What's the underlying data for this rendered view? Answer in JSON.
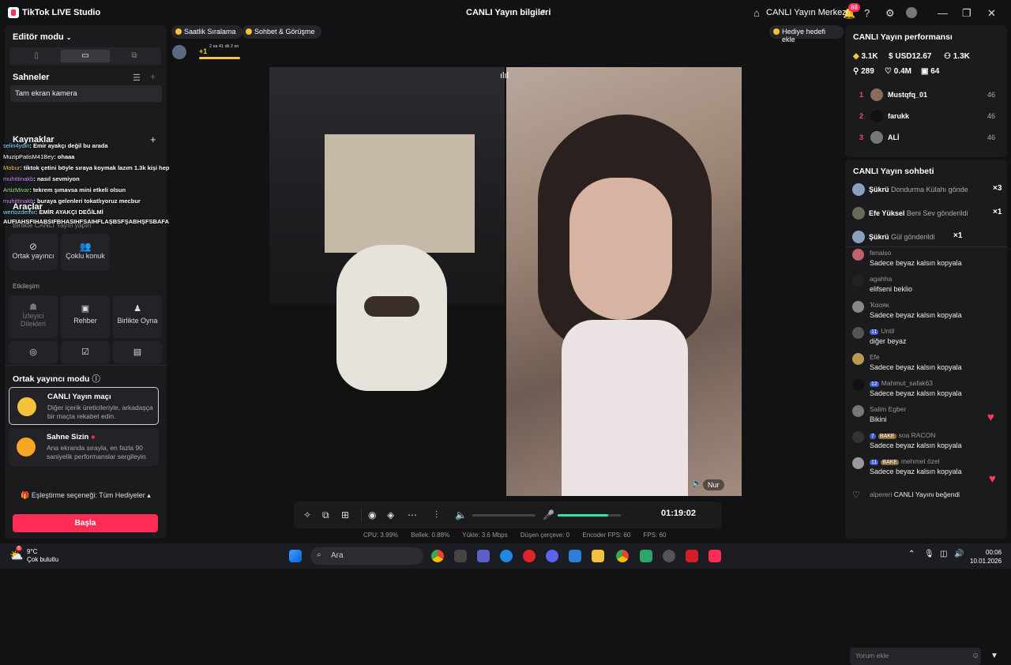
{
  "titlebar": {
    "app_title": "TikTok LIVE Studio",
    "live_info": "CANLI Yayın bilgileri",
    "center_label": "CANLI Yayın Merkezi",
    "notif_count": "88"
  },
  "left": {
    "editor_mode": "Editör modu",
    "scenes_title": "Sahneler",
    "scene_item": "Tam ekran kamera",
    "sources_title": "Kaynaklar",
    "tools_title": "Araçlar",
    "together_title": "Birlikte CANLI Yayın yapın",
    "cohost_label": "Ortak yayıncı",
    "multi_guest_label": "Çoklu konuk",
    "interaction_title": "Etkileşim",
    "viewer_wishes": "İzleyici Dilekleri",
    "guide": "Rehber",
    "play_together": "Birlikte Oyna",
    "cohost_mode_title": "Ortak yayıncı modu",
    "match_title": "CANLI Yayın maçı",
    "match_desc": "Diğer içerik üreticileriyle, arkadaşça bir maçta rekabet edin.",
    "stage_title": "Sahne Sizin",
    "stage_desc": "Ana ekranda sırayla, en fazla 90 saniyelik performanslar sergileyin.",
    "match_option": "Eşleştirme seçeneği: Tüm Hediyeler",
    "start_button": "Başla"
  },
  "overlay_chat": [
    {
      "user": "selin4ydin",
      "text": ": Emir ayakçı değil bu arada"
    },
    {
      "user": "MuzipPatisM41Bey",
      "text": ": ohaaa"
    },
    {
      "user": "Mobur",
      "text": ": tiktok çetini böyle sıraya koymak lazım 1.3k kişi hepsi bi tur tokat"
    },
    {
      "user": "muhittinakb",
      "text": ": nasıl sevmiyon"
    },
    {
      "user": "ArtizMivar",
      "text": ": tekrem şımavsa mini etkeli olsun"
    },
    {
      "user": "muhittinakb",
      "text": ": buraya gelenleri tokatlıyoruz mecbur"
    },
    {
      "user": "wertozdemir",
      "text": ": EMİR AYAKÇI DEĞİLMİ"
    },
    {
      "user": "",
      "text": "AUFIAHSFIHABSIFBHASIHFSAIHFLAŞBSFŞABHŞFSBAFABFŞABŞFŞGBABGŞABGŞABGŞB"
    }
  ],
  "stage": {
    "pill_ranking": "Saatlik Sıralama",
    "pill_chat": "Sohbet & Görüşme",
    "gift_goal": "Hediye hedefi ekle",
    "plus_one": "+1",
    "time_left": "2 sa 41 dk 2 sn",
    "guest_name": "Nur",
    "timer": "01:19:02",
    "mic_level": 0.8
  },
  "stats": {
    "cpu": "CPU: 3.99%",
    "mem": "Bellek: 0.88%",
    "upload": "Yükle: 3.6 Mbps",
    "dropped": "Düşen çerçeve: 0",
    "encoder": "Encoder FPS: 60",
    "fps": "FPS: 60"
  },
  "performance": {
    "title": "CANLI Yayın performansı",
    "diamonds": "3.1K",
    "usd": "USD12.67",
    "viewers": "1.3K",
    "new_followers": "289",
    "likes": "0.4M",
    "gifters": "64",
    "ranking": [
      {
        "rank": "1",
        "name": "Mustqfq_01",
        "score": "46"
      },
      {
        "rank": "2",
        "name": "farukk",
        "score": "46"
      },
      {
        "rank": "3",
        "name": "ALİ",
        "score": "46"
      }
    ]
  },
  "chat": {
    "title": "CANLI Yayın sohbeti",
    "gifts": [
      {
        "user": "Şükrü",
        "text": "Dondurma Külahı gönde",
        "count": "×3"
      },
      {
        "user": "Efe Yüksel",
        "text": "Beni Sev gönderildi",
        "count": "×1"
      },
      {
        "user": "Şükrü",
        "text": "Gül gönderildi",
        "count": "×1"
      }
    ],
    "messages": [
      {
        "user": "fenaiso",
        "badge": "",
        "badge2": "",
        "text": "Sadece beyaz kalsın kopyala"
      },
      {
        "user": "agahha",
        "badge": "",
        "badge2": "",
        "text": "elifseni beklio"
      },
      {
        "user": "Ҡααяк",
        "badge": "",
        "badge2": "",
        "text": "Sadece beyaz kalsın kopyala"
      },
      {
        "user": "Until",
        "badge": "11",
        "badge2": "",
        "text": "diğer beyaz"
      },
      {
        "user": "Efe",
        "badge": "",
        "badge2": "",
        "text": "Sadece beyaz kalsın kopyala"
      },
      {
        "user": "Mahmut_safak63",
        "badge": "12",
        "badge2": "",
        "text": "Sadece beyaz kalsın kopyala"
      },
      {
        "user": "Salim Egber",
        "badge": "",
        "badge2": "",
        "text": "Bikini"
      },
      {
        "user": "soa RACON",
        "badge": "7",
        "badge2": "BAKE",
        "text": "Sadece beyaz kalsın kopyala"
      },
      {
        "user": "mehmet özel",
        "badge": "11",
        "badge2": "BAKE",
        "text": "Sadece beyaz kalsın kopyala"
      }
    ],
    "like_user": "alpereri",
    "like_text": "CANLI Yayını beğendi",
    "comment_placeholder": "Yorum ekle"
  },
  "taskbar": {
    "temp": "9°C",
    "weather": "Çok bulutlu",
    "search": "Ara",
    "time": "00:06",
    "date": "10.01.2026",
    "weather_badge": "6"
  }
}
